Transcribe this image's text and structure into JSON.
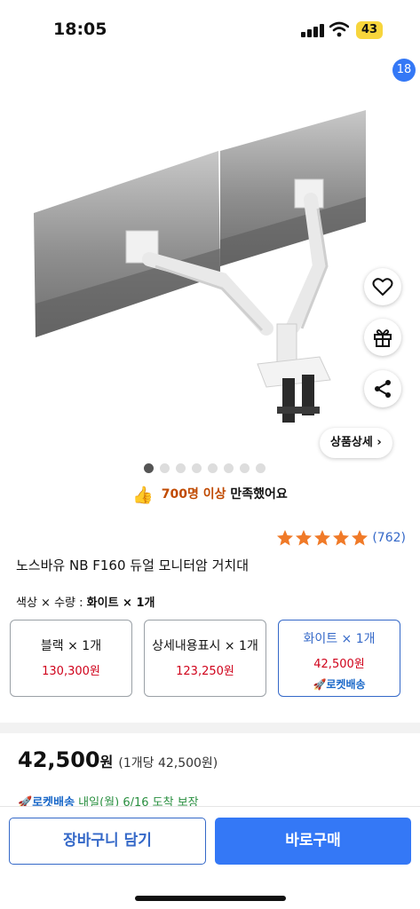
{
  "status_bar": {
    "time": "18:05",
    "battery": "43"
  },
  "header": {
    "cart_count": "18"
  },
  "side_actions": {
    "detail_label": "상품상세"
  },
  "carousel": {
    "total": 8,
    "active_index": 0
  },
  "satisfaction": {
    "highlight": "700명 이상",
    "rest": "만족했어요"
  },
  "rating": {
    "stars": 5,
    "review_count": "(762)"
  },
  "product": {
    "title": "노스바유 NB F160 듀얼 모니터암 거치대"
  },
  "option_summary": {
    "prefix": "색상 × 수량 :",
    "selected": "화이트 × 1개"
  },
  "options": [
    {
      "name": "블랙 × 1개",
      "price": "130,300원",
      "rocket": ""
    },
    {
      "name": "상세내용표시 × 1개",
      "price": "123,250원",
      "rocket": ""
    },
    {
      "name": "화이트 × 1개",
      "price": "42,500원",
      "rocket": "로켓배송"
    }
  ],
  "price": {
    "main": "42,500",
    "unit": "원",
    "per_unit": "(1개당 42,500원)"
  },
  "delivery": {
    "rocket": "로켓배송",
    "text": "내일(월) 6/16 도착 보장"
  },
  "buttons": {
    "cart": "장바구니 담기",
    "buy": "바로구매"
  },
  "colors": {
    "accent": "#3478f6",
    "price_red": "#d0021b",
    "star": "#f07a28"
  }
}
